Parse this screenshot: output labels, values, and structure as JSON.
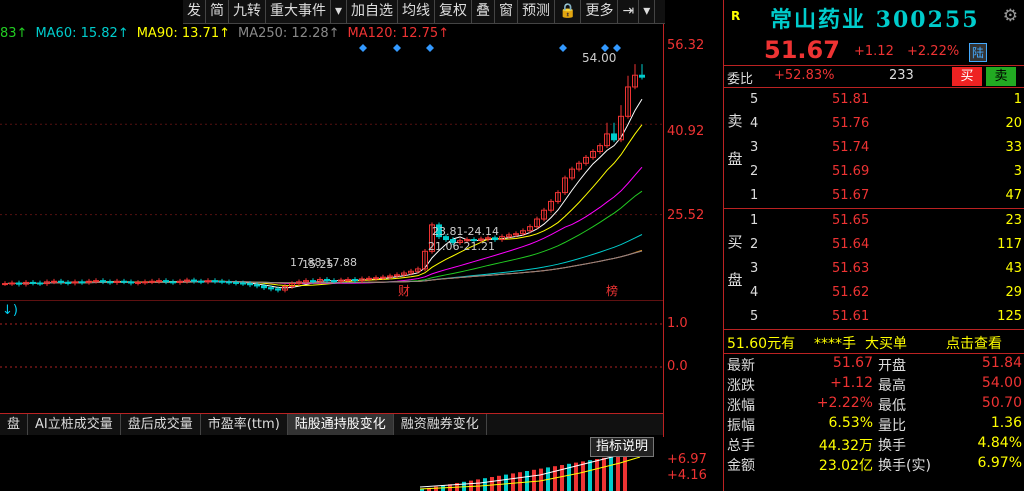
{
  "toolbar": {
    "buttons": [
      {
        "label": "发",
        "flag": false
      },
      {
        "label": "简",
        "flag": true
      },
      {
        "label": "九转",
        "flag": true
      },
      {
        "label": "重大事件",
        "flag": false
      },
      {
        "label": "▾",
        "flag": false
      },
      {
        "label": "加自选",
        "flag": false
      },
      {
        "label": "均线",
        "flag": false
      },
      {
        "label": "复权",
        "flag": false
      },
      {
        "label": "叠",
        "flag": false
      },
      {
        "label": "窗",
        "flag": false
      },
      {
        "label": "预测",
        "flag": false
      },
      {
        "label": "🔒",
        "flag": false
      },
      {
        "label": "更多",
        "flag": false
      },
      {
        "label": "⇥",
        "flag": false
      },
      {
        "label": "▾",
        "flag": false
      }
    ]
  },
  "ma_legend": [
    {
      "text": "83↑",
      "color": "#2c2"
    },
    {
      "text": "MA60: 15.82↑",
      "color": "#0cc"
    },
    {
      "text": "MA90: 13.71↑",
      "color": "#ff0"
    },
    {
      "text": "MA250: 12.28↑",
      "color": "#888"
    },
    {
      "text": "MA120: 12.75↑",
      "color": "#e33"
    }
  ],
  "colors": {
    "up": "#e33",
    "down": "#0cc",
    "accent": "#ff0",
    "axis": "#b22"
  },
  "chart_data": {
    "type": "candlestick",
    "y_ticks": [
      "56.32",
      "40.92",
      "25.52"
    ],
    "sub_ticks": [
      "1.0",
      "0.0"
    ],
    "ylim": [
      12,
      58
    ],
    "annotations": {
      "high_label": "54.00",
      "range_labels": [
        "23.81-24.14",
        "21.06-21.21",
        "17.88-17.88",
        "15.25"
      ],
      "markers": [
        "财",
        "榜"
      ]
    },
    "closes": [
      16.5,
      16.6,
      16.4,
      16.7,
      16.6,
      16.5,
      16.8,
      16.9,
      16.7,
      16.6,
      16.8,
      16.7,
      16.9,
      17.0,
      16.8,
      16.7,
      16.9,
      16.8,
      16.6,
      16.7,
      16.8,
      16.9,
      17.0,
      16.8,
      16.7,
      16.9,
      17.1,
      16.9,
      16.8,
      17.0,
      16.9,
      16.8,
      16.7,
      16.6,
      16.5,
      16.3,
      16.1,
      15.8,
      15.6,
      15.4,
      16.0,
      16.5,
      16.8,
      17.0,
      16.9,
      17.2,
      17.0,
      16.9,
      17.1,
      17.2,
      17.0,
      17.3,
      17.4,
      17.5,
      17.6,
      17.8,
      18.0,
      18.3,
      18.6,
      19.0,
      22.0,
      26.5,
      24.5,
      24.0,
      23.5,
      23.8,
      24.0,
      23.9,
      24.1,
      24.3,
      24.0,
      24.5,
      24.8,
      25.0,
      25.5,
      26.2,
      27.5,
      29.0,
      30.5,
      32.0,
      34.5,
      36.0,
      37.0,
      38.0,
      39.0,
      40.0,
      42.0,
      41.0,
      45.0,
      50.0,
      52.0,
      51.67
    ]
  },
  "sub_panel": {
    "label": "↓)"
  },
  "tabs": [
    "盘",
    "AI立桩成交量",
    "盘后成交量",
    "市盈率(ttm)",
    "陆股通持股变化",
    "融资融券变化"
  ],
  "tab_active": "陆股通持股变化",
  "indicator_hint": "指标说明",
  "indicator_values": [
    "+6.97",
    "+4.16"
  ],
  "quote": {
    "flag": "R",
    "name": "常山药业 300255",
    "price": "51.67",
    "change": "+1.12",
    "pct": "+2.22%",
    "lu_badge": "陆",
    "weibi_label": "委比",
    "weibi_value": "+52.83%",
    "weibi_vol": "233",
    "buy_btn": "买",
    "sell_btn": "卖",
    "sell_side_label": "卖盘",
    "buy_side_label": "买盘",
    "asks": [
      {
        "lv": "5",
        "px": "51.81",
        "qty": "1"
      },
      {
        "lv": "4",
        "px": "51.76",
        "qty": "20"
      },
      {
        "lv": "3",
        "px": "51.74",
        "qty": "33"
      },
      {
        "lv": "2",
        "px": "51.69",
        "qty": "3"
      },
      {
        "lv": "1",
        "px": "51.67",
        "qty": "47"
      }
    ],
    "bids": [
      {
        "lv": "1",
        "px": "51.65",
        "qty": "23"
      },
      {
        "lv": "2",
        "px": "51.64",
        "qty": "117"
      },
      {
        "lv": "3",
        "px": "51.63",
        "qty": "43"
      },
      {
        "lv": "4",
        "px": "51.62",
        "qty": "29"
      },
      {
        "lv": "5",
        "px": "51.61",
        "qty": "125"
      }
    ],
    "big_order": {
      "a": "51.60元有",
      "b": "****手",
      "c": "大买单",
      "d": "点击查看"
    },
    "stats": [
      {
        "k1": "最新",
        "v1": "51.67",
        "c1": "red",
        "k2": "开盘",
        "v2": "51.84",
        "c2": "red"
      },
      {
        "k1": "涨跌",
        "v1": "+1.12",
        "c1": "red",
        "k2": "最高",
        "v2": "54.00",
        "c2": "red"
      },
      {
        "k1": "涨幅",
        "v1": "+2.22%",
        "c1": "red",
        "k2": "最低",
        "v2": "50.70",
        "c2": "red"
      },
      {
        "k1": "振幅",
        "v1": "6.53%",
        "c1": "yel",
        "k2": "量比",
        "v2": "1.36",
        "c2": "yel"
      },
      {
        "k1": "总手",
        "v1": "44.32万",
        "c1": "yel",
        "k2": "换手",
        "v2": "4.84%",
        "c2": "yel"
      },
      {
        "k1": "金额",
        "v1": "23.02亿",
        "c1": "yel",
        "k2": "换手(实)",
        "v2": "6.97%",
        "c2": "yel"
      }
    ]
  }
}
